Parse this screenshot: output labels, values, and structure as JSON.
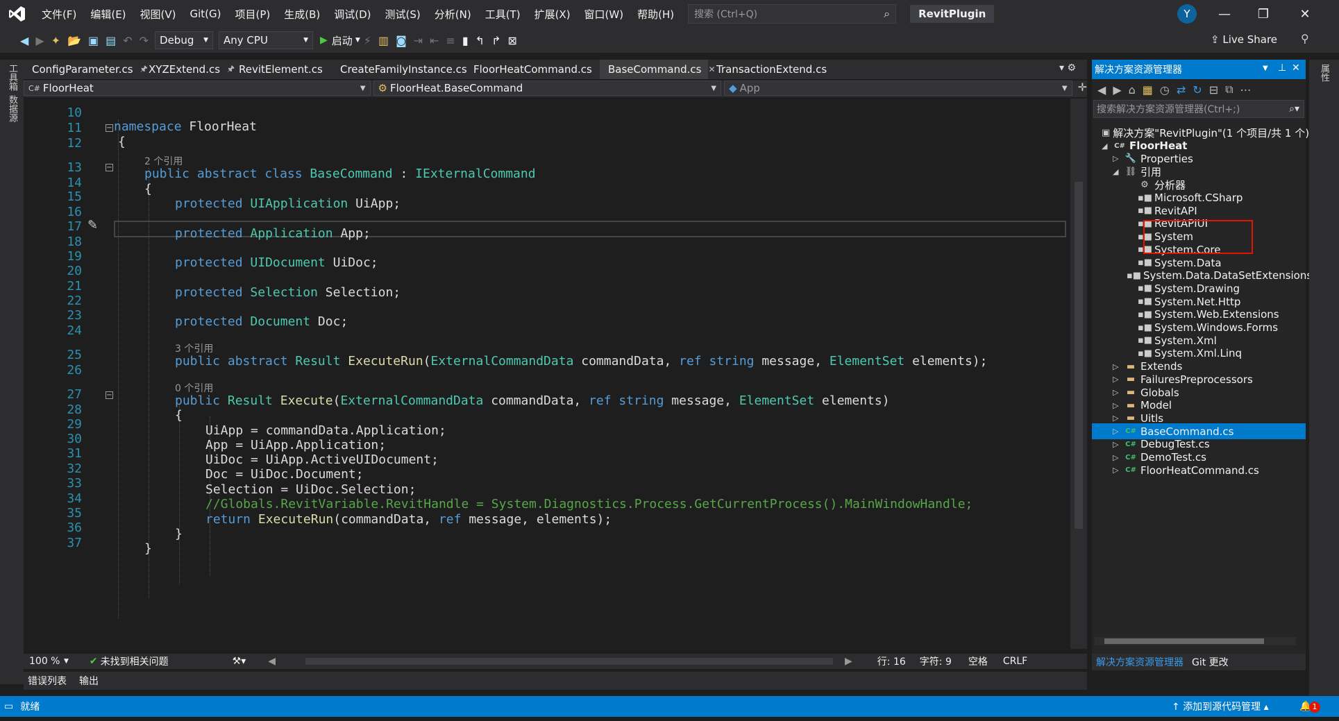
{
  "titlebar": {
    "menu": [
      "文件(F)",
      "编辑(E)",
      "视图(V)",
      "Git(G)",
      "项目(P)",
      "生成(B)",
      "调试(D)",
      "测试(S)",
      "分析(N)",
      "工具(T)",
      "扩展(X)",
      "窗口(W)",
      "帮助(H)"
    ],
    "search_placeholder": "搜索 (Ctrl+Q)",
    "solution": "RevitPlugin",
    "avatar": "Y"
  },
  "toolbar": {
    "config": "Debug",
    "platform": "Any CPU",
    "start": "启动",
    "live_share": "Live Share"
  },
  "left_strip": [
    "工具箱",
    "数据源"
  ],
  "right_strip": [
    "属性"
  ],
  "tabs": [
    {
      "label": "ConfigParameter.cs",
      "pin": "🖈"
    },
    {
      "label": "XYZExtend.cs",
      "pin": "🖈"
    },
    {
      "label": "RevitElement.cs",
      "pin": ""
    },
    {
      "label": "CreateFamilyInstance.cs",
      "pin": ""
    },
    {
      "label": "FloorHeatCommand.cs",
      "pin": ""
    },
    {
      "label": "BaseCommand.cs",
      "pin": "✕"
    },
    {
      "label": "TransactionExtend.cs",
      "pin": ""
    }
  ],
  "navbar": {
    "project": "FloorHeat",
    "type": "FloorHeat.BaseCommand",
    "member": "App"
  },
  "editor": {
    "line_numbers": [
      "10",
      "11",
      "12",
      "13",
      "14",
      "15",
      "16",
      "17",
      "18",
      "19",
      "20",
      "21",
      "22",
      "23",
      "24",
      "25",
      "26",
      "27",
      "28",
      "29",
      "30",
      "31",
      "32",
      "33",
      "34",
      "35",
      "36",
      "37"
    ],
    "codelens": [
      "2 个引用",
      "3 个引用",
      "0 个引用"
    ]
  },
  "status_line": {
    "zoom": "100 %",
    "issues": "未找到相关问题",
    "line": "行: 16",
    "char": "字符: 9",
    "spaces": "空格",
    "eol": "CRLF"
  },
  "bottom_tabs": [
    "错误列表",
    "输出"
  ],
  "statusbar": {
    "ready": "就绪",
    "source_control": "添加到源代码管理",
    "notifications": "1"
  },
  "solution_explorer": {
    "title": "解决方案资源管理器",
    "search_placeholder": "搜索解决方案资源管理器(Ctrl+;)",
    "items": [
      {
        "label": "解决方案\"RevitPlugin\"(1 个项目/共 1 个)",
        "kind": "solution",
        "depth": 0,
        "expander": ""
      },
      {
        "label": "FloorHeat",
        "kind": "csproj",
        "depth": 0,
        "expander": "◢"
      },
      {
        "label": "Properties",
        "kind": "wrench",
        "depth": 1,
        "expander": "▷"
      },
      {
        "label": "引用",
        "kind": "refs",
        "depth": 1,
        "expander": "◢"
      },
      {
        "label": "分析器",
        "kind": "analyzer",
        "depth": 2,
        "expander": ""
      },
      {
        "label": "Microsoft.CSharp",
        "kind": "ref",
        "depth": 2,
        "expander": ""
      },
      {
        "label": "RevitAPI",
        "kind": "ref",
        "depth": 2,
        "expander": ""
      },
      {
        "label": "RevitAPIUI",
        "kind": "ref",
        "depth": 2,
        "expander": ""
      },
      {
        "label": "System",
        "kind": "ref",
        "depth": 2,
        "expander": ""
      },
      {
        "label": "System.Core",
        "kind": "ref",
        "depth": 2,
        "expander": ""
      },
      {
        "label": "System.Data",
        "kind": "ref",
        "depth": 2,
        "expander": ""
      },
      {
        "label": "System.Data.DataSetExtensions",
        "kind": "ref",
        "depth": 2,
        "expander": ""
      },
      {
        "label": "System.Drawing",
        "kind": "ref",
        "depth": 2,
        "expander": ""
      },
      {
        "label": "System.Net.Http",
        "kind": "ref",
        "depth": 2,
        "expander": ""
      },
      {
        "label": "System.Web.Extensions",
        "kind": "ref",
        "depth": 2,
        "expander": ""
      },
      {
        "label": "System.Windows.Forms",
        "kind": "ref",
        "depth": 2,
        "expander": ""
      },
      {
        "label": "System.Xml",
        "kind": "ref",
        "depth": 2,
        "expander": ""
      },
      {
        "label": "System.Xml.Linq",
        "kind": "ref",
        "depth": 2,
        "expander": ""
      },
      {
        "label": "Extends",
        "kind": "folder",
        "depth": 1,
        "expander": "▷"
      },
      {
        "label": "FailuresPreprocessors",
        "kind": "folder",
        "depth": 1,
        "expander": "▷"
      },
      {
        "label": "Globals",
        "kind": "folder",
        "depth": 1,
        "expander": "▷"
      },
      {
        "label": "Model",
        "kind": "folder",
        "depth": 1,
        "expander": "▷"
      },
      {
        "label": "Uitls",
        "kind": "folder",
        "depth": 1,
        "expander": "▷"
      },
      {
        "label": "BaseCommand.cs",
        "kind": "cs",
        "depth": 1,
        "expander": "▷",
        "selected": true
      },
      {
        "label": "DebugTest.cs",
        "kind": "cs",
        "depth": 1,
        "expander": "▷"
      },
      {
        "label": "DemoTest.cs",
        "kind": "cs",
        "depth": 1,
        "expander": "▷"
      },
      {
        "label": "FloorHeatCommand.cs",
        "kind": "cs",
        "depth": 1,
        "expander": "▷"
      }
    ],
    "tabs": [
      "解决方案资源管理器",
      "Git 更改"
    ]
  },
  "colors": {
    "accent": "#007acc",
    "highlight_box": "#e51400"
  }
}
